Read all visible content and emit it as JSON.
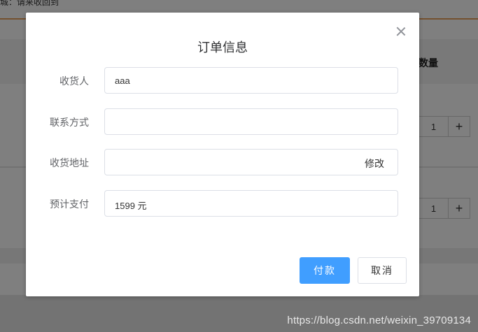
{
  "background": {
    "topbar_text": "城：请来收回到",
    "column_header": "数量",
    "rows": [
      {
        "quantity": "1",
        "plus": "+"
      },
      {
        "quantity": "1",
        "plus": "+"
      }
    ]
  },
  "dialog": {
    "title": "订单信息",
    "close_icon": "close-icon",
    "fields": [
      {
        "label": "收货人",
        "value": "aaa"
      },
      {
        "label": "联系方式",
        "value": ""
      },
      {
        "label": "收货地址",
        "value": "",
        "action": "修改"
      },
      {
        "label": "预计支付",
        "value": "1599 元"
      }
    ],
    "pay_button": "付款",
    "cancel_button": "取消"
  },
  "watermark": "https://blog.csdn.net/weixin_39709134",
  "colors": {
    "primary": "#409eff",
    "accent_border": "#e8a15c"
  }
}
